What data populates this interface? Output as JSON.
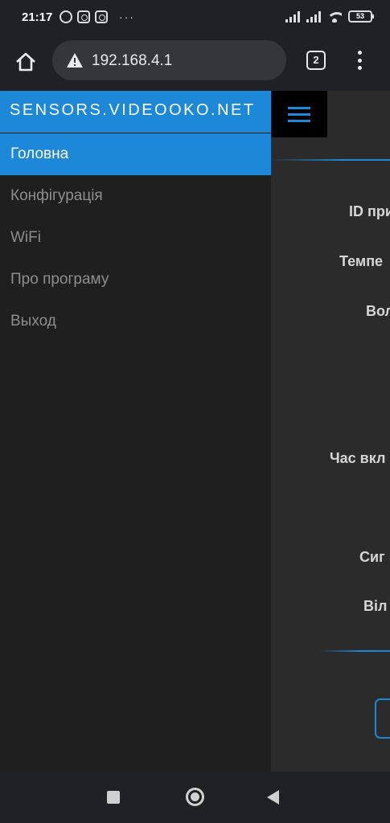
{
  "status_bar": {
    "time": "21:17",
    "notification_icons": [
      "viber-icon",
      "instagram-icon",
      "instagram-icon"
    ],
    "more_indicator": "···",
    "battery_level": "53"
  },
  "browser": {
    "url": "192.168.4.1",
    "tab_count": "2",
    "security_icon": "warning-icon"
  },
  "sidebar": {
    "brand": "SENSORS.VIDEOOKO.NET",
    "items": [
      {
        "label": "Головна",
        "active": true
      },
      {
        "label": "Конфігурація",
        "active": false
      },
      {
        "label": "WiFi",
        "active": false
      },
      {
        "label": "Про програму",
        "active": false
      },
      {
        "label": "Выход",
        "active": false
      }
    ]
  },
  "main": {
    "fields": [
      "ID при",
      "Темпе",
      "Вол",
      "Час вкл",
      "Сиг",
      "Віл"
    ]
  },
  "colors": {
    "accent": "#1e88d8",
    "sidebar_bg": "#1f1f1f",
    "content_bg": "#2b2b2b"
  }
}
